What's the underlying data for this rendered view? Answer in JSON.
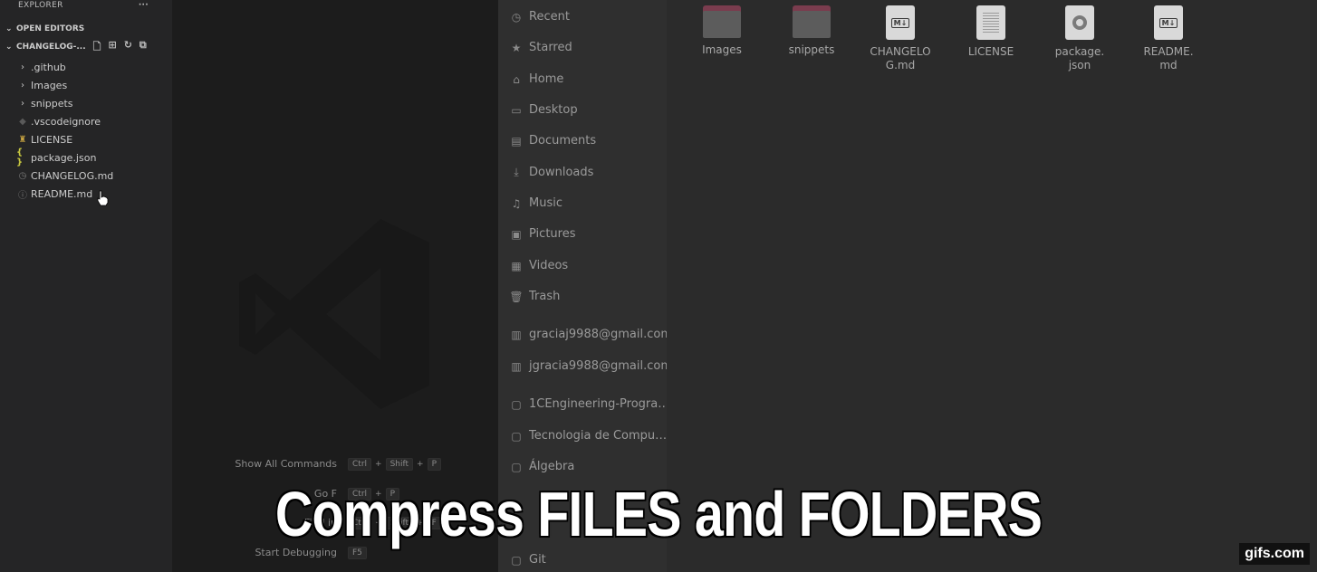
{
  "vscode": {
    "explorer_title": "EXPLORER",
    "more_actions": "···",
    "open_editors_label": "OPEN EDITORS",
    "project_label": "CHANGELOG-...",
    "tree": [
      {
        "label": ".github",
        "icon": "chevron-right-icon",
        "glyph": "›"
      },
      {
        "label": "Images",
        "icon": "chevron-right-icon",
        "glyph": "›"
      },
      {
        "label": "snippets",
        "icon": "chevron-right-icon",
        "glyph": "›"
      },
      {
        "label": ".vscodeignore",
        "icon": "diamond-icon",
        "glyph": "◆"
      },
      {
        "label": "LICENSE",
        "icon": "license-icon",
        "glyph": "♜"
      },
      {
        "label": "package.json",
        "icon": "json-icon",
        "glyph": "{ }"
      },
      {
        "label": "CHANGELOG.md",
        "icon": "clock-icon",
        "glyph": "◷"
      },
      {
        "label": "README.md",
        "icon": "info-icon",
        "glyph": "ⓘ"
      }
    ],
    "shortcuts": [
      {
        "label": "Show All Commands",
        "keys": [
          "Ctrl",
          "Shift",
          "P"
        ]
      },
      {
        "label": "Go F",
        "keys": [
          "Ctrl",
          "P"
        ]
      },
      {
        "label": "Find in",
        "keys": [
          "Ctrl",
          "Shift",
          "F"
        ]
      },
      {
        "label": "Start Debugging",
        "keys": [
          "F5"
        ]
      }
    ]
  },
  "file_manager": {
    "places": [
      {
        "label": "Recent",
        "icon": "clock-icon",
        "glyph": "◷"
      },
      {
        "label": "Starred",
        "icon": "star-icon",
        "glyph": "★"
      },
      {
        "label": "Home",
        "icon": "home-icon",
        "glyph": "⌂"
      },
      {
        "label": "Desktop",
        "icon": "desktop-icon",
        "glyph": "▭"
      },
      {
        "label": "Documents",
        "icon": "documents-icon",
        "glyph": "▤"
      },
      {
        "label": "Downloads",
        "icon": "download-icon",
        "glyph": "⤓"
      },
      {
        "label": "Music",
        "icon": "music-icon",
        "glyph": "♫"
      },
      {
        "label": "Pictures",
        "icon": "pictures-icon",
        "glyph": "▣"
      },
      {
        "label": "Videos",
        "icon": "videos-icon",
        "glyph": "▦"
      },
      {
        "label": "Trash",
        "icon": "trash-icon",
        "glyph": "🗑"
      },
      {
        "label": "graciaj9988@gmail.com",
        "icon": "network-drive-icon",
        "glyph": "▥"
      },
      {
        "label": "jgracia9988@gmail.com",
        "icon": "network-drive-icon",
        "glyph": "▥"
      },
      {
        "label": "1CEngineering-Progra…",
        "icon": "folder-icon",
        "glyph": "▢"
      },
      {
        "label": "Tecnologia de Compu…",
        "icon": "folder-icon",
        "glyph": "▢"
      },
      {
        "label": "Álgebra",
        "icon": "folder-icon",
        "glyph": "▢"
      },
      {
        "label": "Git",
        "icon": "folder-icon",
        "glyph": "▢"
      }
    ],
    "items": [
      {
        "label": "Images",
        "type": "folder"
      },
      {
        "label": "snippets",
        "type": "folder"
      },
      {
        "label": "CHANGELO G.md",
        "type": "markdown",
        "line1": "CHANGELO",
        "line2": "G.md"
      },
      {
        "label": "LICENSE",
        "type": "text",
        "line1": "LICENSE",
        "line2": ""
      },
      {
        "label": "package. json",
        "type": "json",
        "line1": "package.",
        "line2": "json"
      },
      {
        "label": "README. md",
        "type": "markdown",
        "line1": "README.",
        "line2": "md"
      }
    ]
  },
  "overlay": {
    "caption": "Compress FILES and FOLDERS",
    "watermark": "gifs.com"
  }
}
